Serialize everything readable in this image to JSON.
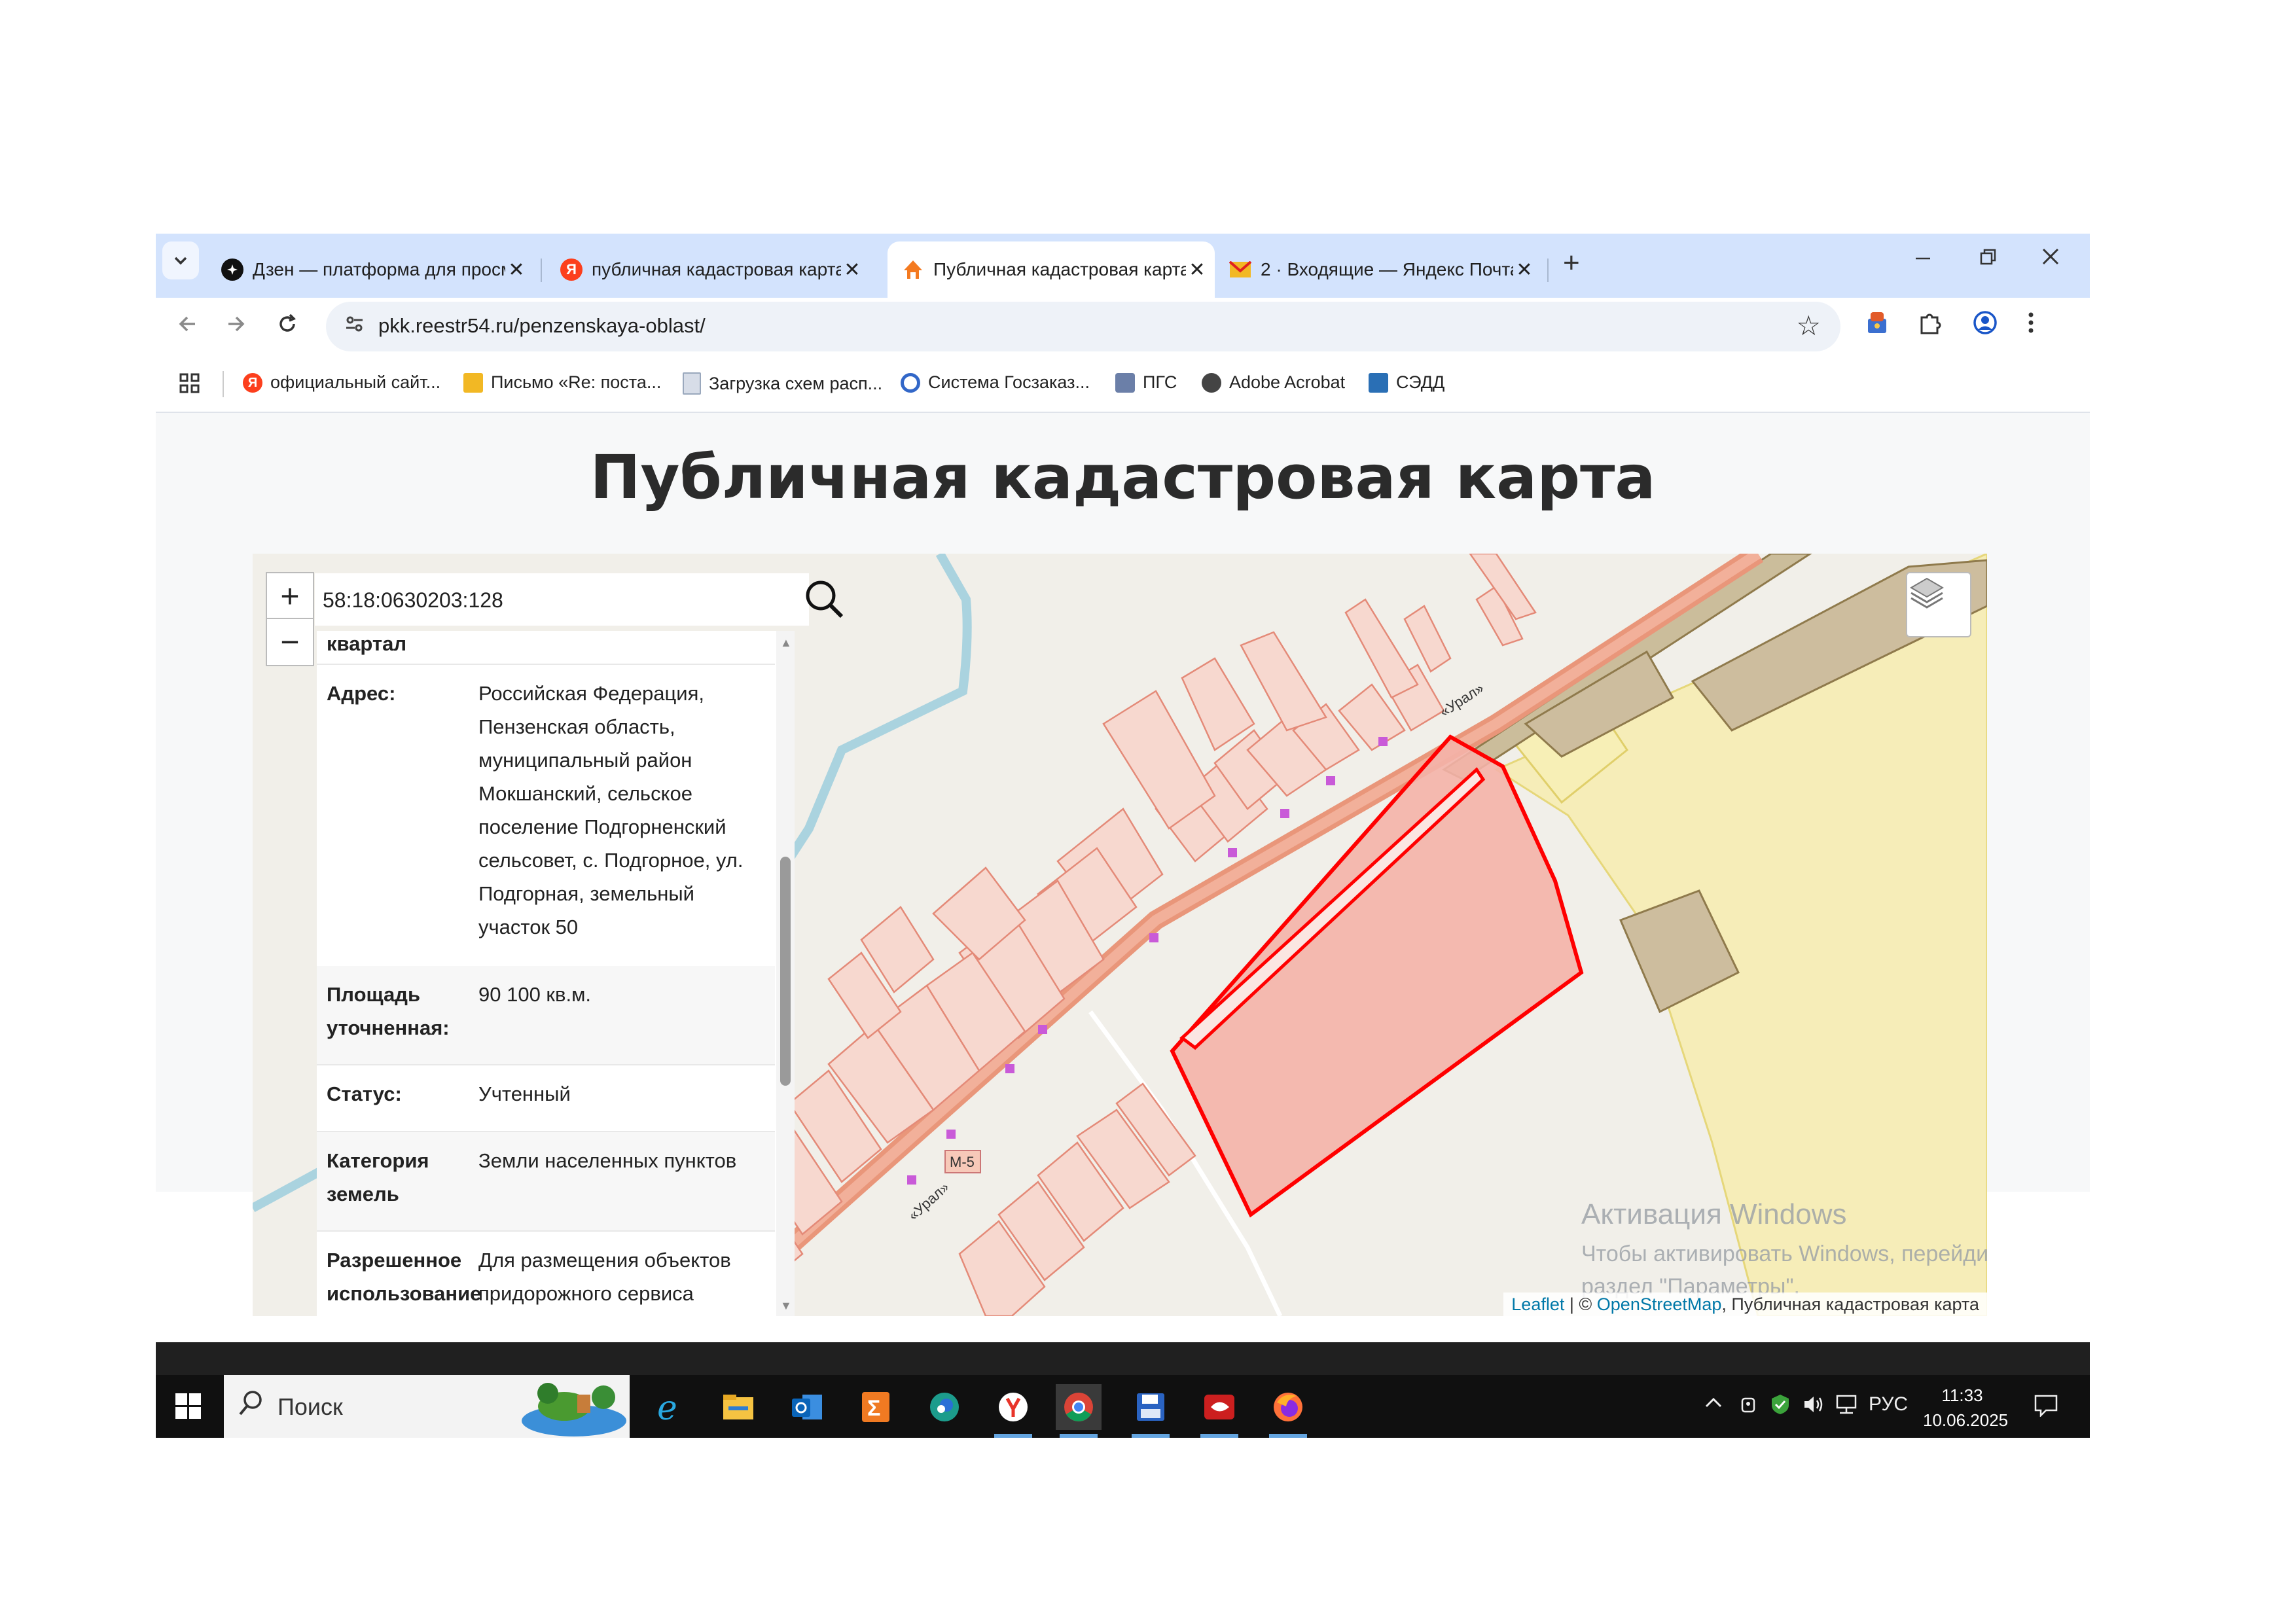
{
  "browser": {
    "tabs": [
      {
        "title": "Дзен — платформа для просм",
        "active": false,
        "icon": "dzen-icon"
      },
      {
        "title": "публичная кадастровая карта",
        "active": false,
        "icon": "yandex-icon"
      },
      {
        "title": "Публичная кадастровая карта",
        "active": true,
        "icon": "pkk-icon"
      },
      {
        "title": "2 · Входящие — Яндекс Почта",
        "active": false,
        "icon": "mail-icon"
      }
    ],
    "tab_close": "✕",
    "new_tab": "+",
    "url": "pkk.reestr54.ru/penzenskaya-oblast/",
    "bookmarks": [
      {
        "label": "официальный сайт...",
        "icon": "yandex-icon",
        "color": "#fc3f1d"
      },
      {
        "label": "Письмо «Re: поста...",
        "icon": "mail-icon",
        "color": "#f2b824"
      },
      {
        "label": "Загрузка схем расп...",
        "icon": "doc-icon",
        "color": "#9aa8bd"
      },
      {
        "label": "Система Госзаказ...",
        "icon": "goszakaz-icon",
        "color": "#3267c8"
      },
      {
        "label": "ПГС",
        "icon": "emblem-icon",
        "color": "#6b7fa8"
      },
      {
        "label": "Adobe Acrobat",
        "icon": "globe-icon",
        "color": "#444444"
      },
      {
        "label": "СЭДД",
        "icon": "briefcase-icon",
        "color": "#2a6fb5"
      }
    ]
  },
  "page": {
    "title": "Публичная кадастровая карта"
  },
  "map": {
    "zoom_in": "+",
    "zoom_out": "−",
    "search_value": "58:18:0630203:128",
    "info_partial_label": "квартал",
    "info": [
      {
        "label": "Адрес:",
        "value": "Российская Федерация, Пензенская область, муниципальный район Мокшанский, сельское поселение Подгорненский сельсовет, с. Подгорное, ул. Подгорная, земельный участок 50"
      },
      {
        "label": "Площадь уточненная:",
        "value": "90 100 кв.м."
      },
      {
        "label": "Статус:",
        "value": "Учтенный"
      },
      {
        "label": "Категория земель",
        "value": "Земли населенных пунктов"
      },
      {
        "label": "Разрешенное использование",
        "value": "Для размещения объектов придорожного сервиса"
      }
    ],
    "road_labels": [
      "«Урал»",
      "«Урал»",
      "М-5"
    ],
    "attribution": {
      "leaflet": "Leaflet",
      "sep": " | © ",
      "osm": "OpenStreetMap",
      "rest": ", Публичная кадастровая карта"
    },
    "watermark_title": "Активация Windows",
    "watermark_text": "Чтобы активировать Windows, перейдите в раздел \"Параметры\".",
    "colors": {
      "selected_parcel": "#ff0000",
      "parcel_fill": "#f4b3a8",
      "road": "#e9967a"
    }
  },
  "taskbar": {
    "search_label": "Поиск",
    "language": "РУС",
    "time": "11:33",
    "date": "10.06.2025"
  }
}
